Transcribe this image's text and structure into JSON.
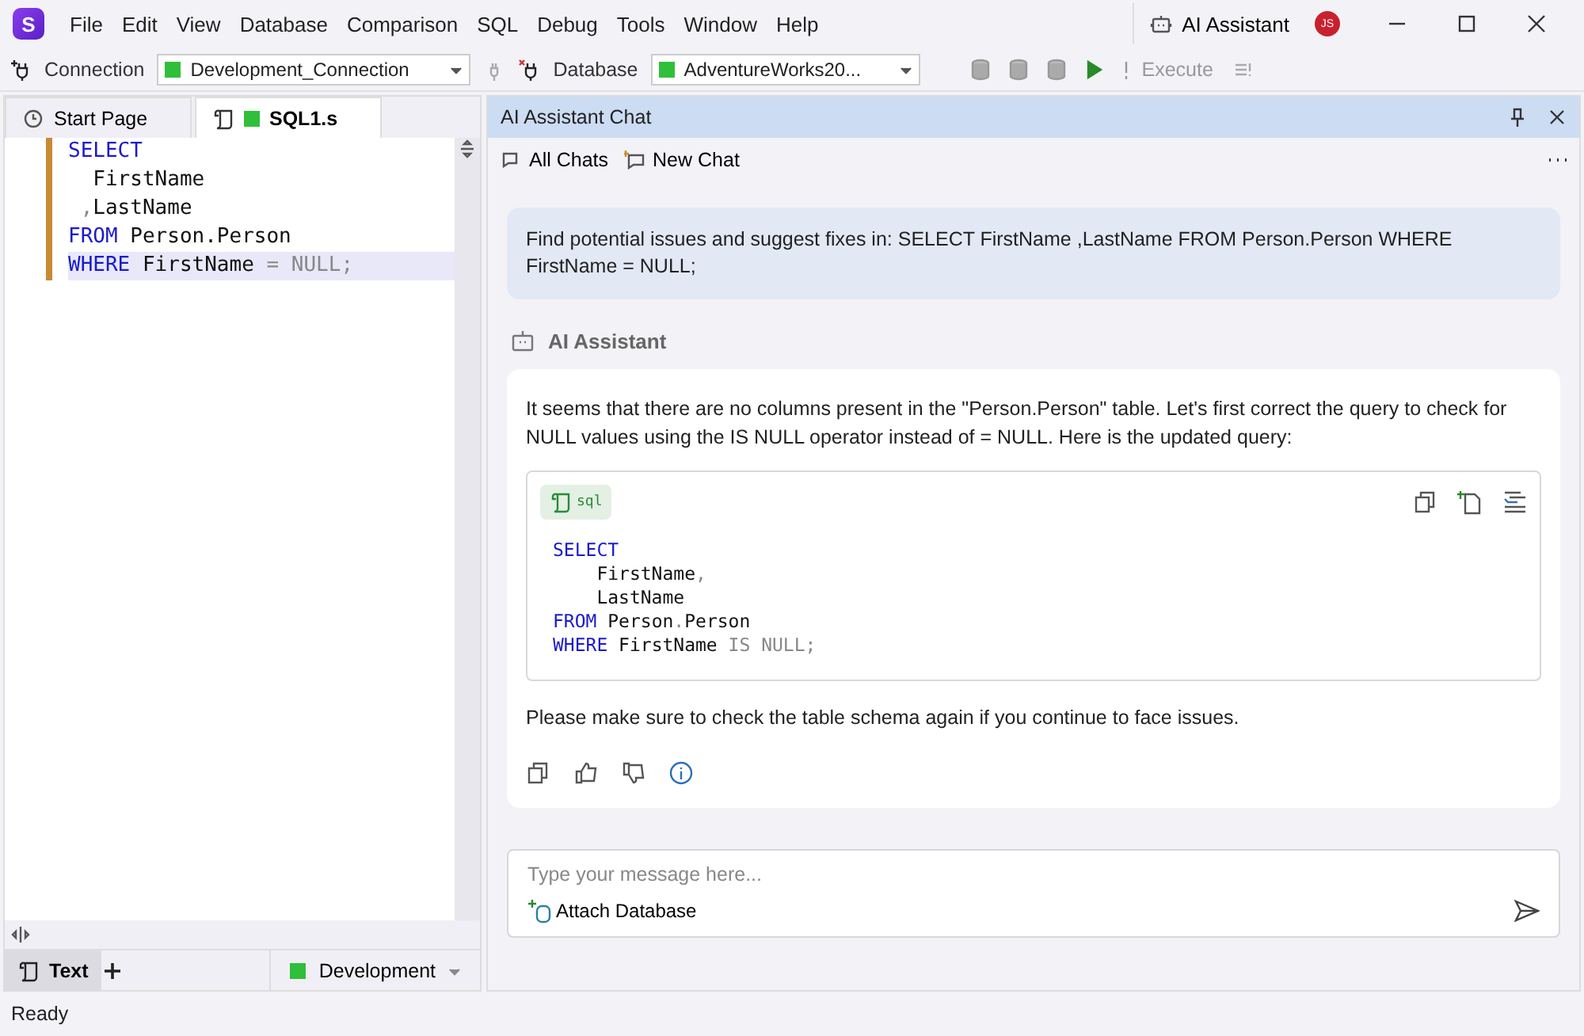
{
  "logo": {
    "letter": "S"
  },
  "menu": [
    {
      "label": "File"
    },
    {
      "label": "Edit"
    },
    {
      "label": "View"
    },
    {
      "label": "Database"
    },
    {
      "label": "Comparison"
    },
    {
      "label": "SQL"
    },
    {
      "label": "Debug"
    },
    {
      "label": "Tools"
    },
    {
      "label": "Window"
    },
    {
      "label": "Help"
    }
  ],
  "title_bar": {
    "assistant_button": "AI Assistant",
    "avatar": "JS"
  },
  "toolbar": {
    "connection_label": "Connection",
    "connection": "Development_Connection",
    "database_label": "Database",
    "database": "AdventureWorks20...",
    "execute": {
      "label": "Execute",
      "disabled": true
    }
  },
  "editor_tabs": [
    {
      "label": "Start Page",
      "selected": false,
      "kind": "start"
    },
    {
      "label": "SQL1.s",
      "selected": true,
      "kind": "sql"
    }
  ],
  "editor": {
    "lines": [
      {
        "selected": false,
        "tokens": [
          {
            "text": "SELECT",
            "kind": "kw"
          }
        ]
      },
      {
        "selected": false,
        "tokens": [
          {
            "text": "  FirstName",
            "kind": "id"
          }
        ]
      },
      {
        "selected": false,
        "tokens": [
          {
            "text": " ,",
            "kind": "op"
          },
          {
            "text": "LastName",
            "kind": "id"
          }
        ]
      },
      {
        "selected": false,
        "tokens": [
          {
            "text": "FROM",
            "kind": "kw"
          },
          {
            "text": " Person.Person",
            "kind": "id"
          }
        ]
      },
      {
        "selected": true,
        "tokens": [
          {
            "text": "WHERE",
            "kind": "kw"
          },
          {
            "text": " FirstName ",
            "kind": "id"
          },
          {
            "text": "= NULL;",
            "kind": "op"
          }
        ]
      }
    ]
  },
  "bottom_bar": {
    "tabs": [
      {
        "label": "Text",
        "selected": true
      }
    ],
    "connection": "Development"
  },
  "status_bar": "Ready",
  "chat": {
    "title": "AI Assistant Chat",
    "toolbar": [
      {
        "label": "All Chats",
        "kind": "chats"
      },
      {
        "label": "New Chat",
        "kind": "new"
      }
    ],
    "user_message": "Find potential issues and suggest fixes in: SELECT FirstName ,LastName FROM Person.Person WHERE FirstName = NULL;",
    "assistant_name": "AI Assistant",
    "reply_intro": "It seems that there are no columns present in the \"Person.Person\" table. Let's first correct the query to check for NULL values using the IS NULL operator instead of = NULL. Here is the updated query:",
    "code_language": "sql",
    "code_lines": [
      {
        "tokens": [
          {
            "text": "SELECT",
            "kind": "kw"
          }
        ]
      },
      {
        "tokens": [
          {
            "text": "    FirstName",
            "kind": "id"
          },
          {
            "text": ",",
            "kind": "op"
          }
        ]
      },
      {
        "tokens": [
          {
            "text": "    LastName",
            "kind": "id"
          }
        ]
      },
      {
        "tokens": [
          {
            "text": "FROM",
            "kind": "kw"
          },
          {
            "text": " Person",
            "kind": "id"
          },
          {
            "text": ".",
            "kind": "op"
          },
          {
            "text": "Person",
            "kind": "id"
          }
        ]
      },
      {
        "tokens": [
          {
            "text": "WHERE",
            "kind": "kw"
          },
          {
            "text": " FirstName ",
            "kind": "id"
          },
          {
            "text": "IS NULL;",
            "kind": "op"
          }
        ]
      }
    ],
    "reply_outro": "Please make sure to check the table schema again if you continue to face issues.",
    "input_placeholder": "Type your message here...",
    "attach": "Attach Database"
  }
}
